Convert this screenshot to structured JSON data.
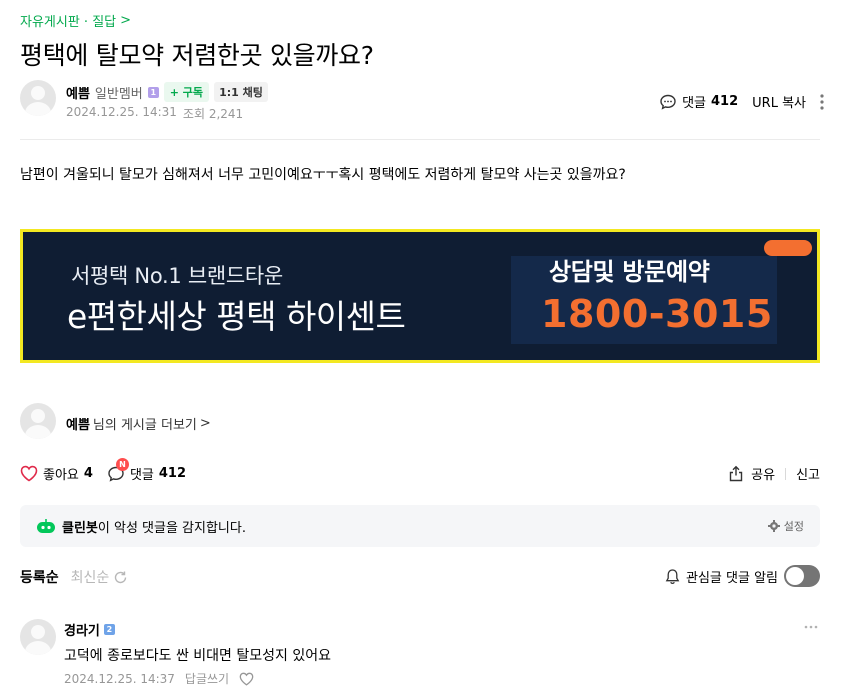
{
  "breadcrumb": {
    "label": "자유게시판 · 질답",
    "chevron": ">"
  },
  "post": {
    "title": "평택에 탈모약 저렴한곳 있을까요?",
    "author": {
      "nickname": "예쁨",
      "grade": "일반멤버",
      "grade_badge": "1",
      "subscribe_label": "+ 구독",
      "chat_label": "1:1 채팅"
    },
    "date": "2024.12.25. 14:31",
    "views_label": "조회 2,241",
    "tools": {
      "comment_label": "댓글",
      "comment_count": "412",
      "copy_url_label": "URL 복사"
    },
    "body": "남편이 겨울되니 탈모가 심해져서 너무 고민이예요ㅜㅜ혹시 평택에도 저렴하게 탈모약 사는곳  있을까요?",
    "banner": {
      "sub": "서평택 No.1 브랜드타운",
      "main": "e편한세상 평택 하이센트",
      "cta": "상담및 방문예약",
      "phone": "1800-3015"
    }
  },
  "more_posts": {
    "nickname": "예쁨",
    "suffix": "님의 게시글 더보기",
    "chevron": ">"
  },
  "reactions": {
    "like_label": "좋아요",
    "like_count": "4",
    "comment_label": "댓글",
    "comment_count": "412",
    "new_badge": "N",
    "share_label": "공유",
    "report_label": "신고"
  },
  "cleanbot": {
    "name": "클린봇",
    "message": "이 악성 댓글을 감지합니다.",
    "settings_label": "설정"
  },
  "comments_header": {
    "sort_registered": "등록순",
    "sort_latest": "최신순",
    "alarm_label": "관심글 댓글 알림"
  },
  "comments": [
    {
      "author": "경라기",
      "grade_badge": "2",
      "text": "고덕에 종로보다도 싼 비대면 탈모성지 있어요",
      "date": "2024.12.25. 14:37",
      "reply_label": "답글쓰기"
    }
  ],
  "colors": {
    "accent_green": "#03a94d",
    "banner_bg": "#0f1d33",
    "banner_border": "#f3e821",
    "banner_orange": "#f36f30"
  }
}
